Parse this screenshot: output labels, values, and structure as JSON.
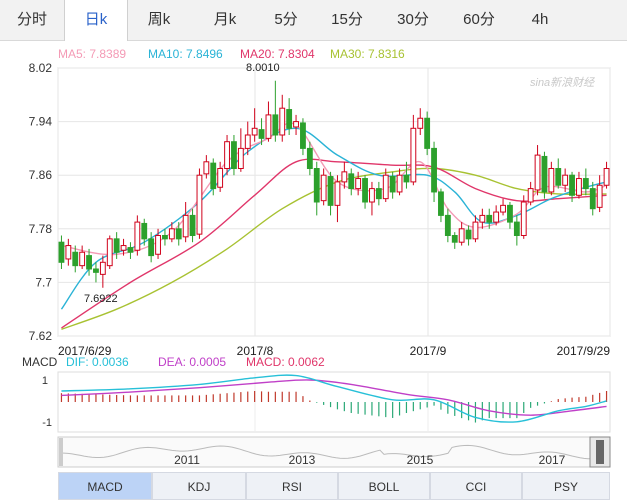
{
  "tabs": [
    {
      "label": "分时",
      "active": false
    },
    {
      "label": "日k",
      "active": true
    },
    {
      "label": "周k",
      "active": false
    },
    {
      "label": "月k",
      "active": false
    },
    {
      "label": "5分",
      "active": false
    },
    {
      "label": "15分",
      "active": false
    },
    {
      "label": "30分",
      "active": false
    },
    {
      "label": "60分",
      "active": false
    },
    {
      "label": "4h",
      "active": false
    }
  ],
  "legend": {
    "ma5": "MA5: 7.8389",
    "ma10": "MA10: 7.8496",
    "ma20": "MA20: 7.8304",
    "ma30": "MA30: 7.8316"
  },
  "watermark": "sina新浪财经",
  "colors": {
    "up": "#d0021b",
    "down": "#2ca02c",
    "ma5": "#f49ab5",
    "ma10": "#2ab3d6",
    "ma20": "#e0366a",
    "ma30": "#a8c232",
    "dif": "#27c0d8",
    "dea": "#c040c8"
  },
  "chart_data": {
    "type": "candlestick",
    "y_ticks": [
      "8.02",
      "7.94",
      "7.86",
      "7.78",
      "7.7",
      "7.62"
    ],
    "ylim": [
      7.62,
      8.02
    ],
    "x_labels": [
      "2017/6/29",
      "2017/8",
      "2017/9",
      "2017/9/29"
    ],
    "annotations": {
      "high": "8.0010",
      "low": "7.6922"
    },
    "candles": [
      [
        7.76,
        7.73,
        7.77,
        7.72
      ],
      [
        7.735,
        7.755,
        7.765,
        7.725
      ],
      [
        7.745,
        7.725,
        7.755,
        7.715
      ],
      [
        7.725,
        7.745,
        7.755,
        7.72
      ],
      [
        7.74,
        7.72,
        7.75,
        7.71
      ],
      [
        7.72,
        7.715,
        7.73,
        7.7
      ],
      [
        7.712,
        7.73,
        7.74,
        7.692
      ],
      [
        7.725,
        7.765,
        7.77,
        7.72
      ],
      [
        7.765,
        7.745,
        7.775,
        7.735
      ],
      [
        7.748,
        7.755,
        7.765,
        7.74
      ],
      [
        7.752,
        7.745,
        7.76,
        7.735
      ],
      [
        7.748,
        7.79,
        7.8,
        7.74
      ],
      [
        7.788,
        7.765,
        7.795,
        7.755
      ],
      [
        7.765,
        7.74,
        7.775,
        7.73
      ],
      [
        7.742,
        7.77,
        7.78,
        7.735
      ],
      [
        7.77,
        7.765,
        7.78,
        7.755
      ],
      [
        7.765,
        7.78,
        7.79,
        7.76
      ],
      [
        7.78,
        7.765,
        7.79,
        7.755
      ],
      [
        7.768,
        7.8,
        7.82,
        7.76
      ],
      [
        7.8,
        7.77,
        7.81,
        7.76
      ],
      [
        7.772,
        7.86,
        7.87,
        7.765
      ],
      [
        7.862,
        7.88,
        7.89,
        7.855
      ],
      [
        7.878,
        7.84,
        7.885,
        7.83
      ],
      [
        7.842,
        7.87,
        7.88,
        7.835
      ],
      [
        7.87,
        7.91,
        7.92,
        7.86
      ],
      [
        7.91,
        7.87,
        7.92,
        7.86
      ],
      [
        7.87,
        7.9,
        7.93,
        7.865
      ],
      [
        7.9,
        7.92,
        7.94,
        7.89
      ],
      [
        7.92,
        7.93,
        7.96,
        7.91
      ],
      [
        7.928,
        7.915,
        7.945,
        7.905
      ],
      [
        7.915,
        7.95,
        7.97,
        7.91
      ],
      [
        7.95,
        7.92,
        8.001,
        7.91
      ],
      [
        7.92,
        7.96,
        7.98,
        7.91
      ],
      [
        7.958,
        7.93,
        7.975,
        7.92
      ],
      [
        7.932,
        7.94,
        7.95,
        7.92
      ],
      [
        7.938,
        7.9,
        7.945,
        7.89
      ],
      [
        7.9,
        7.87,
        7.91,
        7.86
      ],
      [
        7.87,
        7.82,
        7.88,
        7.8
      ],
      [
        7.822,
        7.86,
        7.87,
        7.815
      ],
      [
        7.858,
        7.815,
        7.865,
        7.8
      ],
      [
        7.815,
        7.85,
        7.86,
        7.79
      ],
      [
        7.85,
        7.865,
        7.88,
        7.84
      ],
      [
        7.862,
        7.84,
        7.87,
        7.83
      ],
      [
        7.84,
        7.855,
        7.865,
        7.83
      ],
      [
        7.855,
        7.82,
        7.86,
        7.81
      ],
      [
        7.82,
        7.84,
        7.85,
        7.8
      ],
      [
        7.84,
        7.825,
        7.85,
        7.815
      ],
      [
        7.825,
        7.86,
        7.87,
        7.82
      ],
      [
        7.858,
        7.835,
        7.865,
        7.825
      ],
      [
        7.835,
        7.86,
        7.87,
        7.83
      ],
      [
        7.86,
        7.85,
        7.88,
        7.84
      ],
      [
        7.85,
        7.93,
        7.95,
        7.845
      ],
      [
        7.93,
        7.945,
        7.96,
        7.92
      ],
      [
        7.945,
        7.9,
        7.955,
        7.89
      ],
      [
        7.9,
        7.835,
        7.91,
        7.82
      ],
      [
        7.835,
        7.8,
        7.84,
        7.79
      ],
      [
        7.8,
        7.77,
        7.81,
        7.76
      ],
      [
        7.77,
        7.76,
        7.775,
        7.75
      ],
      [
        7.76,
        7.78,
        7.79,
        7.755
      ],
      [
        7.778,
        7.765,
        7.785,
        7.755
      ],
      [
        7.765,
        7.79,
        7.8,
        7.76
      ],
      [
        7.79,
        7.8,
        7.81,
        7.78
      ],
      [
        7.8,
        7.79,
        7.81,
        7.78
      ],
      [
        7.79,
        7.805,
        7.815,
        7.785
      ],
      [
        7.805,
        7.815,
        7.825,
        7.8
      ],
      [
        7.815,
        7.79,
        7.82,
        7.78
      ],
      [
        7.79,
        7.77,
        7.8,
        7.755
      ],
      [
        7.77,
        7.82,
        7.83,
        7.765
      ],
      [
        7.82,
        7.84,
        7.85,
        7.815
      ],
      [
        7.838,
        7.89,
        7.905,
        7.83
      ],
      [
        7.888,
        7.835,
        7.895,
        7.825
      ],
      [
        7.835,
        7.87,
        7.88,
        7.83
      ],
      [
        7.87,
        7.845,
        7.885,
        7.84
      ],
      [
        7.845,
        7.86,
        7.87,
        7.835
      ],
      [
        7.86,
        7.83,
        7.865,
        7.82
      ],
      [
        7.83,
        7.855,
        7.865,
        7.825
      ],
      [
        7.855,
        7.84,
        7.87,
        7.83
      ],
      [
        7.84,
        7.81,
        7.85,
        7.8
      ],
      [
        7.812,
        7.845,
        7.86,
        7.805
      ],
      [
        7.845,
        7.87,
        7.88,
        7.84
      ]
    ],
    "ma5": [
      [
        0,
        7.755
      ],
      [
        8,
        7.742
      ],
      [
        16,
        7.775
      ],
      [
        24,
        7.88
      ],
      [
        30,
        7.915
      ],
      [
        34,
        7.935
      ],
      [
        40,
        7.85
      ],
      [
        47,
        7.84
      ],
      [
        52,
        7.88
      ],
      [
        56,
        7.81
      ],
      [
        60,
        7.782
      ],
      [
        66,
        7.802
      ],
      [
        70,
        7.842
      ],
      [
        76,
        7.835
      ],
      [
        79,
        7.845
      ]
    ],
    "ma10": [
      [
        0,
        7.66
      ],
      [
        5,
        7.73
      ],
      [
        12,
        7.76
      ],
      [
        20,
        7.82
      ],
      [
        27,
        7.895
      ],
      [
        34,
        7.93
      ],
      [
        40,
        7.89
      ],
      [
        46,
        7.86
      ],
      [
        53,
        7.86
      ],
      [
        57,
        7.835
      ],
      [
        61,
        7.79
      ],
      [
        66,
        7.8
      ],
      [
        71,
        7.825
      ],
      [
        76,
        7.842
      ],
      [
        79,
        7.85
      ]
    ],
    "ma20": [
      [
        0,
        7.632
      ],
      [
        10,
        7.7
      ],
      [
        20,
        7.76
      ],
      [
        28,
        7.83
      ],
      [
        34,
        7.88
      ],
      [
        40,
        7.88
      ],
      [
        48,
        7.875
      ],
      [
        54,
        7.872
      ],
      [
        60,
        7.84
      ],
      [
        66,
        7.822
      ],
      [
        72,
        7.825
      ],
      [
        79,
        7.83
      ]
    ],
    "ma30": [
      [
        0,
        7.63
      ],
      [
        8,
        7.66
      ],
      [
        16,
        7.7
      ],
      [
        24,
        7.75
      ],
      [
        32,
        7.81
      ],
      [
        40,
        7.85
      ],
      [
        48,
        7.865
      ],
      [
        54,
        7.87
      ],
      [
        60,
        7.86
      ],
      [
        66,
        7.84
      ],
      [
        72,
        7.832
      ],
      [
        79,
        7.832
      ]
    ]
  },
  "macd": {
    "label": "MACD",
    "dif": "DIF: 0.0036",
    "dea": "DEA: 0.0005",
    "macd": "MACD: 0.0062",
    "y_ticks": [
      "1",
      "-1"
    ],
    "dif_pts": [
      [
        0,
        0.5
      ],
      [
        10,
        0.6
      ],
      [
        20,
        0.8
      ],
      [
        28,
        1.1
      ],
      [
        34,
        1.2
      ],
      [
        40,
        0.7
      ],
      [
        48,
        0.1
      ],
      [
        54,
        0.1
      ],
      [
        60,
        -0.7
      ],
      [
        66,
        -0.9
      ],
      [
        72,
        -0.4
      ],
      [
        76,
        -0.2
      ],
      [
        79,
        0.05
      ]
    ],
    "dea_pts": [
      [
        0,
        0.3
      ],
      [
        10,
        0.45
      ],
      [
        20,
        0.65
      ],
      [
        30,
        0.9
      ],
      [
        36,
        1.0
      ],
      [
        42,
        0.8
      ],
      [
        50,
        0.35
      ],
      [
        56,
        0.1
      ],
      [
        62,
        -0.4
      ],
      [
        68,
        -0.6
      ],
      [
        74,
        -0.4
      ],
      [
        79,
        -0.2
      ]
    ]
  },
  "navigator": {
    "labels": [
      "2011",
      "2013",
      "2015",
      "2017"
    ]
  },
  "bottom_tabs": [
    {
      "label": "MACD",
      "active": true
    },
    {
      "label": "KDJ",
      "active": false
    },
    {
      "label": "RSI",
      "active": false
    },
    {
      "label": "BOLL",
      "active": false
    },
    {
      "label": "CCI",
      "active": false
    },
    {
      "label": "PSY",
      "active": false
    }
  ]
}
